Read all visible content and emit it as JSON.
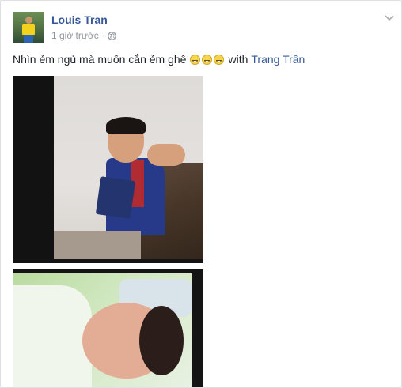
{
  "post": {
    "author_name": "Louis Tran",
    "timestamp": "1 giờ trước",
    "dot": "·",
    "privacy_icon": "globe-icon",
    "menu_icon": "chevron-down-icon",
    "text": "Nhìn ẻm ngủ mà muốn cắn ẻm ghê",
    "emoji_count": 3,
    "with_label": "with",
    "tagged_name": "Trang Trần"
  },
  "colors": {
    "link": "#365899",
    "meta": "#90949c",
    "text": "#1d2129",
    "card_bg": "#ffffff",
    "page_bg": "#e9ebee"
  }
}
